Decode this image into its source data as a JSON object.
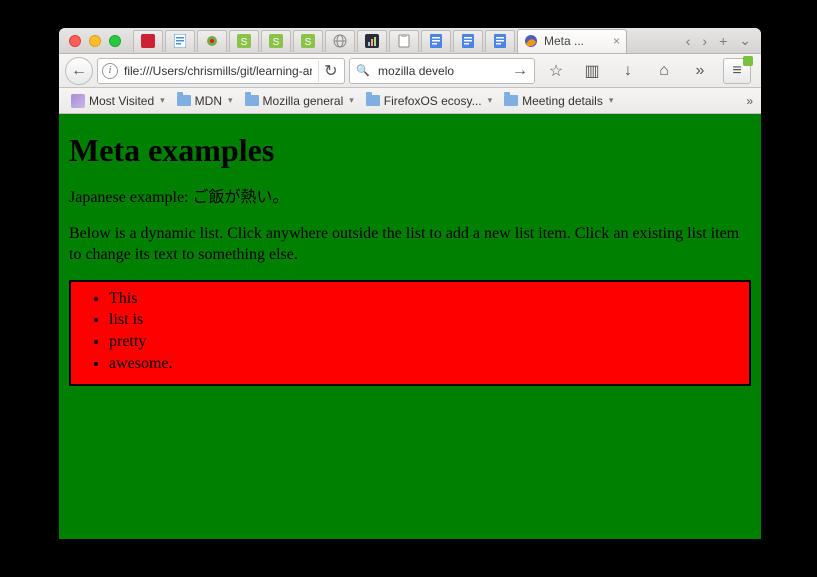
{
  "tab": {
    "title": "Meta ...",
    "close_glyph": "×"
  },
  "tabbar": {
    "nav_left_glyph": "‹",
    "nav_right_glyph": "›",
    "newtab_glyph": "+",
    "overflow_glyph": "⌄"
  },
  "toolbar": {
    "back_glyph": "←",
    "info_glyph": "i",
    "url_value": "file:///Users/chrismills/git/learning-area/h",
    "reload_glyph": "↻",
    "search_glyph": "🔍",
    "search_value": "mozilla develo",
    "search_go_glyph": "→",
    "star_glyph": "☆",
    "library_glyph": "▥",
    "download_glyph": "↓",
    "home_glyph": "⌂",
    "overflow_glyph": "»",
    "menu_glyph": "≡"
  },
  "bookmarks": {
    "items": [
      {
        "label": "Most Visited",
        "icon": "mv"
      },
      {
        "label": "MDN",
        "icon": "folder"
      },
      {
        "label": "Mozilla general",
        "icon": "folder"
      },
      {
        "label": "FirefoxOS ecosy...",
        "icon": "folder"
      },
      {
        "label": "Meeting details",
        "icon": "folder"
      }
    ],
    "drop_glyph": "▾",
    "overflow_glyph": "»"
  },
  "page": {
    "heading": "Meta examples",
    "japanese_line": "Japanese example: ご飯が熱い。",
    "instructions": "Below is a dynamic list. Click anywhere outside the list to add a new list item. Click an existing list item to change its text to something else.",
    "list_items": [
      "This",
      "list is",
      "pretty",
      "awesome."
    ]
  }
}
